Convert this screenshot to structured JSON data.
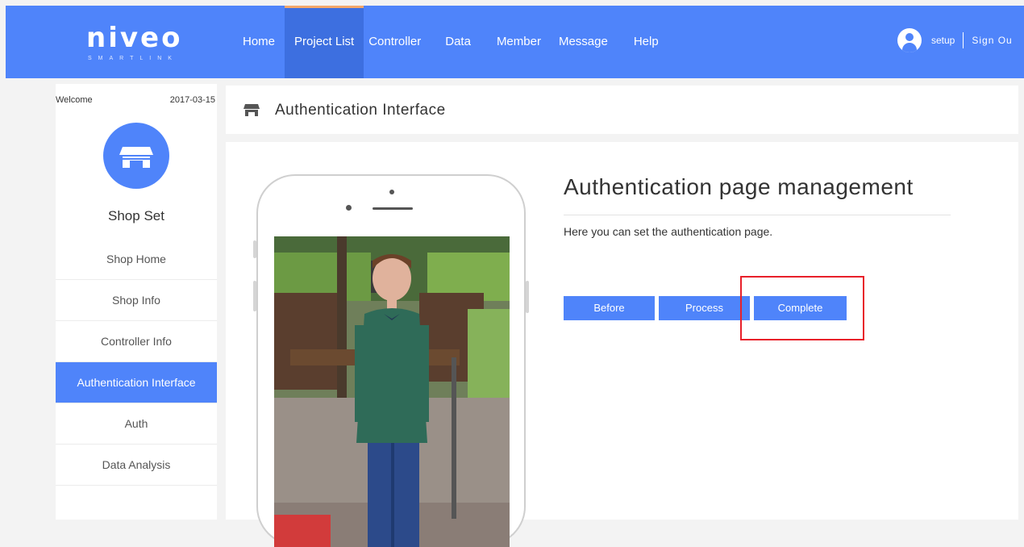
{
  "header": {
    "logo_text": "niveo",
    "logo_sub": "SMARTLINK",
    "nav": [
      {
        "label": "Home"
      },
      {
        "label": "Project List"
      },
      {
        "label": "Controller"
      },
      {
        "label": "Data"
      },
      {
        "label": "Member"
      },
      {
        "label": "Message"
      },
      {
        "label": "Help"
      }
    ],
    "active_nav": "Project List",
    "user": {
      "name": "setup",
      "signout": "Sign Ou"
    }
  },
  "sidebar": {
    "welcome": "Welcome",
    "date": "2017-03-15",
    "shop_title": "Shop Set",
    "menu": [
      {
        "label": "Shop Home"
      },
      {
        "label": "Shop Info"
      },
      {
        "label": "Controller Info"
      },
      {
        "label": "Authentication Interface"
      },
      {
        "label": "Auth"
      },
      {
        "label": "Data Analysis"
      }
    ],
    "active_menu": "Authentication Interface"
  },
  "page": {
    "header_title": "Authentication Interface",
    "title": "Authentication page management",
    "description": "Here you can set the authentication page.",
    "steps": [
      {
        "label": "Before"
      },
      {
        "label": "Process"
      },
      {
        "label": "Complete"
      }
    ],
    "highlighted_step": "Complete"
  },
  "colors": {
    "brand": "#4f84fa",
    "highlight_box": "#e8202a",
    "nav_active_accent": "#f2a76a"
  }
}
